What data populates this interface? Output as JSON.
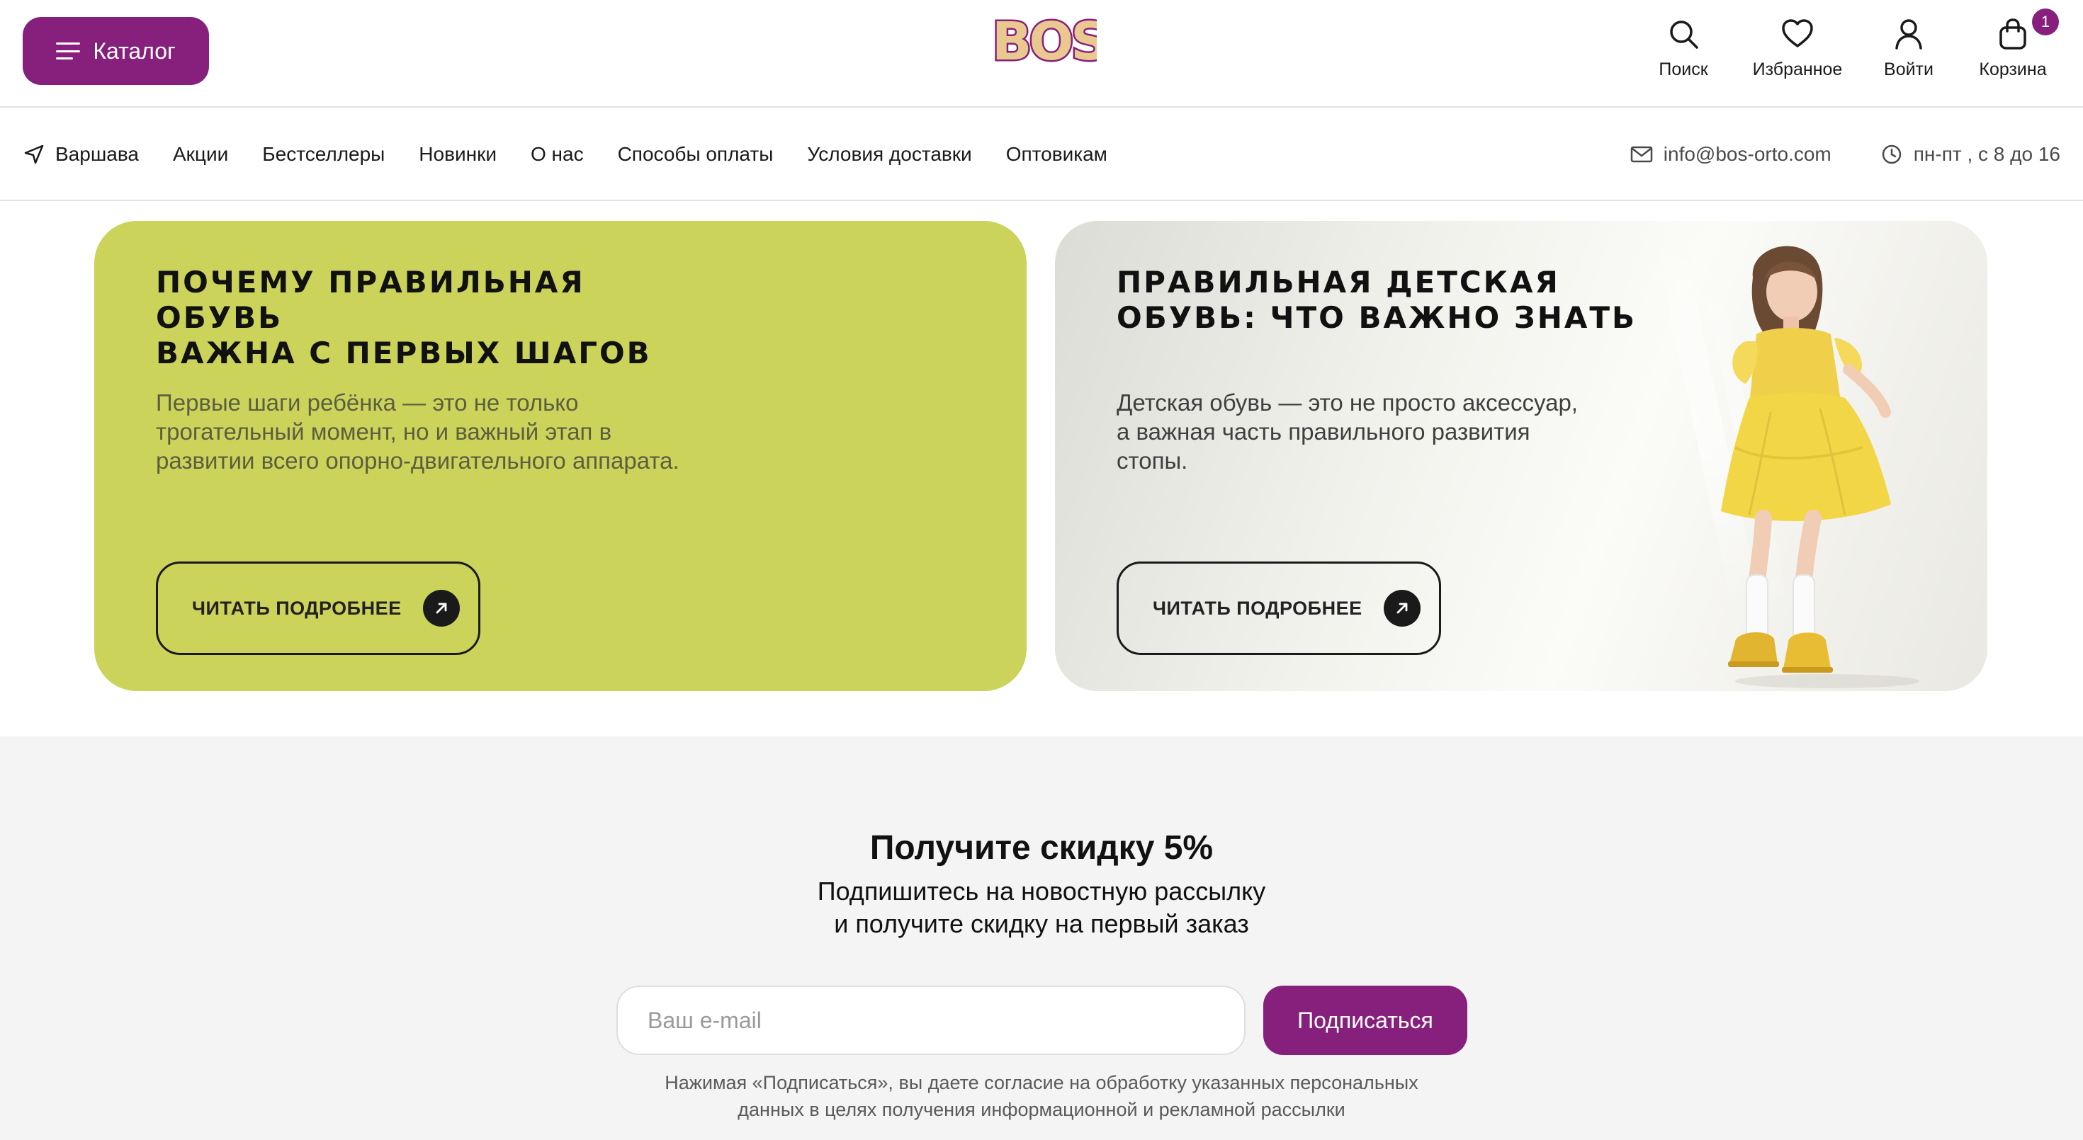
{
  "header": {
    "catalog_label": "Каталог",
    "logo_text": "BOS",
    "actions": {
      "search": "Поиск",
      "favorites": "Избранное",
      "login": "Войти",
      "cart": "Корзина",
      "cart_count": "1"
    }
  },
  "nav": {
    "city": "Варшава",
    "items": [
      "Акции",
      "Бестселлеры",
      "Новинки",
      "О нас",
      "Способы оплаты",
      "Условия доставки",
      "Оптовикам"
    ],
    "email": "info@bos-orto.com",
    "hours": "пн-пт , с 8 до 16"
  },
  "cards": [
    {
      "title_line1": "Почему правильная обувь",
      "title_line2": "важна с первых шагов",
      "desc_line1": "Первые шаги ребёнка — это не только",
      "desc_line2": "трогательный момент, но и важный этап в",
      "desc_line3": "развитии всего опорно-двигательного аппарата.",
      "button": "ЧИТАТЬ ПОДРОБНЕЕ",
      "bg_color": "#cbd35b"
    },
    {
      "title_line1": "Правильная детская",
      "title_line2": "обувь: что важно знать",
      "desc_line1": "Детская обувь — это не просто аксессуар,",
      "desc_line2": "а важная часть правильного развития",
      "desc_line3": "стопы.",
      "button": "ЧИТАТЬ ПОДРОБНЕЕ"
    }
  ],
  "subscribe": {
    "title": "Получите скидку 5%",
    "text_line1": "Подпишитесь на новостную рассылку",
    "text_line2": "и получите скидку на первый заказ",
    "email_placeholder": "Ваш e-mail",
    "button": "Подписаться",
    "note_line1": "Нажимая «Подписаться», вы даете согласие на обработку указанных персональных",
    "note_line2": "данных в целях получения информационной и рекламной рассылки"
  },
  "colors": {
    "brand": "#87207d",
    "card_green": "#cbd35b",
    "subscribe_bg": "#f5f4f4"
  },
  "icons": [
    "menu-icon",
    "search-icon",
    "heart-icon",
    "user-icon",
    "bag-icon",
    "location-arrow-icon",
    "mail-icon",
    "clock-icon",
    "arrow-up-right-icon"
  ]
}
